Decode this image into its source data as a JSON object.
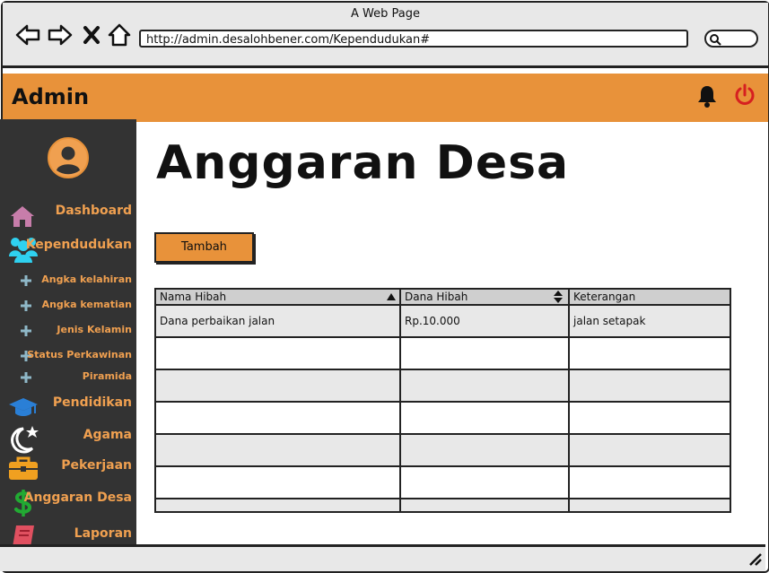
{
  "browser": {
    "window_title": "A Web Page",
    "url": "http://admin.desalohbener.com/Kependudukan#"
  },
  "appbar": {
    "title": "Admin"
  },
  "sidebar": {
    "items": [
      {
        "label": "Dashboard",
        "icon": "home-icon",
        "color": "#c77daa"
      },
      {
        "label": "Kependudukan",
        "icon": "users-icon",
        "color": "#2fd1f0"
      },
      {
        "label": "Angka kelahiran",
        "icon": "plus-icon"
      },
      {
        "label": "Angka kematian",
        "icon": "plus-icon"
      },
      {
        "label": "Jenis Kelamin",
        "icon": "plus-icon"
      },
      {
        "label": "Status Perkawinan",
        "icon": "plus-icon"
      },
      {
        "label": "Piramida",
        "icon": "plus-icon"
      },
      {
        "label": "Pendidikan",
        "icon": "graduation-cap-icon",
        "color": "#2a7fd6"
      },
      {
        "label": "Agama",
        "icon": "moon-star-icon",
        "color": "#ffffff"
      },
      {
        "label": "Pekerjaan",
        "icon": "briefcase-icon",
        "color": "#f0a020"
      },
      {
        "label": "Anggaran Desa",
        "icon": "dollar-icon",
        "color": "#22aa33"
      },
      {
        "label": "Laporan",
        "icon": "book-icon",
        "color": "#e05060"
      }
    ]
  },
  "main": {
    "title": "Anggaran Desa",
    "add_button": "Tambah",
    "table": {
      "columns": [
        "Nama Hibah",
        "Dana Hibah",
        "Keterangan"
      ],
      "rows": [
        [
          "Dana perbaikan jalan",
          "Rp.10.000",
          "jalan setapak"
        ]
      ]
    }
  },
  "colors": {
    "accent": "#e8923a",
    "sidebar_bg": "#333333",
    "sidebar_text": "#f0a050",
    "power": "#d62020"
  }
}
